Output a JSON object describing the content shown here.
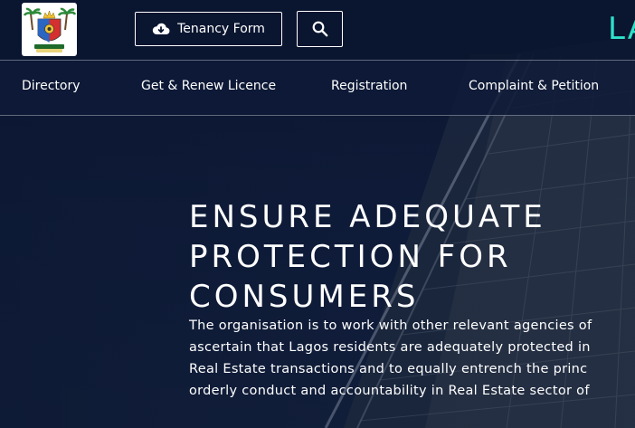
{
  "header": {
    "brand_text": "LA",
    "tenancy_button": {
      "label": "Tenancy Form",
      "icon": "cloud-download-icon"
    },
    "search_button": {
      "icon": "search-icon"
    },
    "logo": {
      "icon": "lagos-state-crest-logo"
    }
  },
  "nav": {
    "items": [
      {
        "label": "Directory"
      },
      {
        "label": "Get & Renew Licence"
      },
      {
        "label": "Registration"
      },
      {
        "label": "Complaint & Petition"
      }
    ]
  },
  "hero": {
    "headline_lines": [
      "ENSURE ADEQUATE",
      "PROTECTION FOR",
      "CONSUMERS"
    ],
    "description_lines": [
      "The organisation is to work with other relevant agencies of",
      "ascertain that Lagos residents are adequately protected in",
      "Real Estate transactions and to equally entrench the princ",
      "orderly conduct and accountability in Real Estate sector of"
    ]
  },
  "colors": {
    "brand_accent": "#2ee0c8",
    "header_bg": "#0b1630",
    "hero_bg": "#0f1c3a"
  }
}
